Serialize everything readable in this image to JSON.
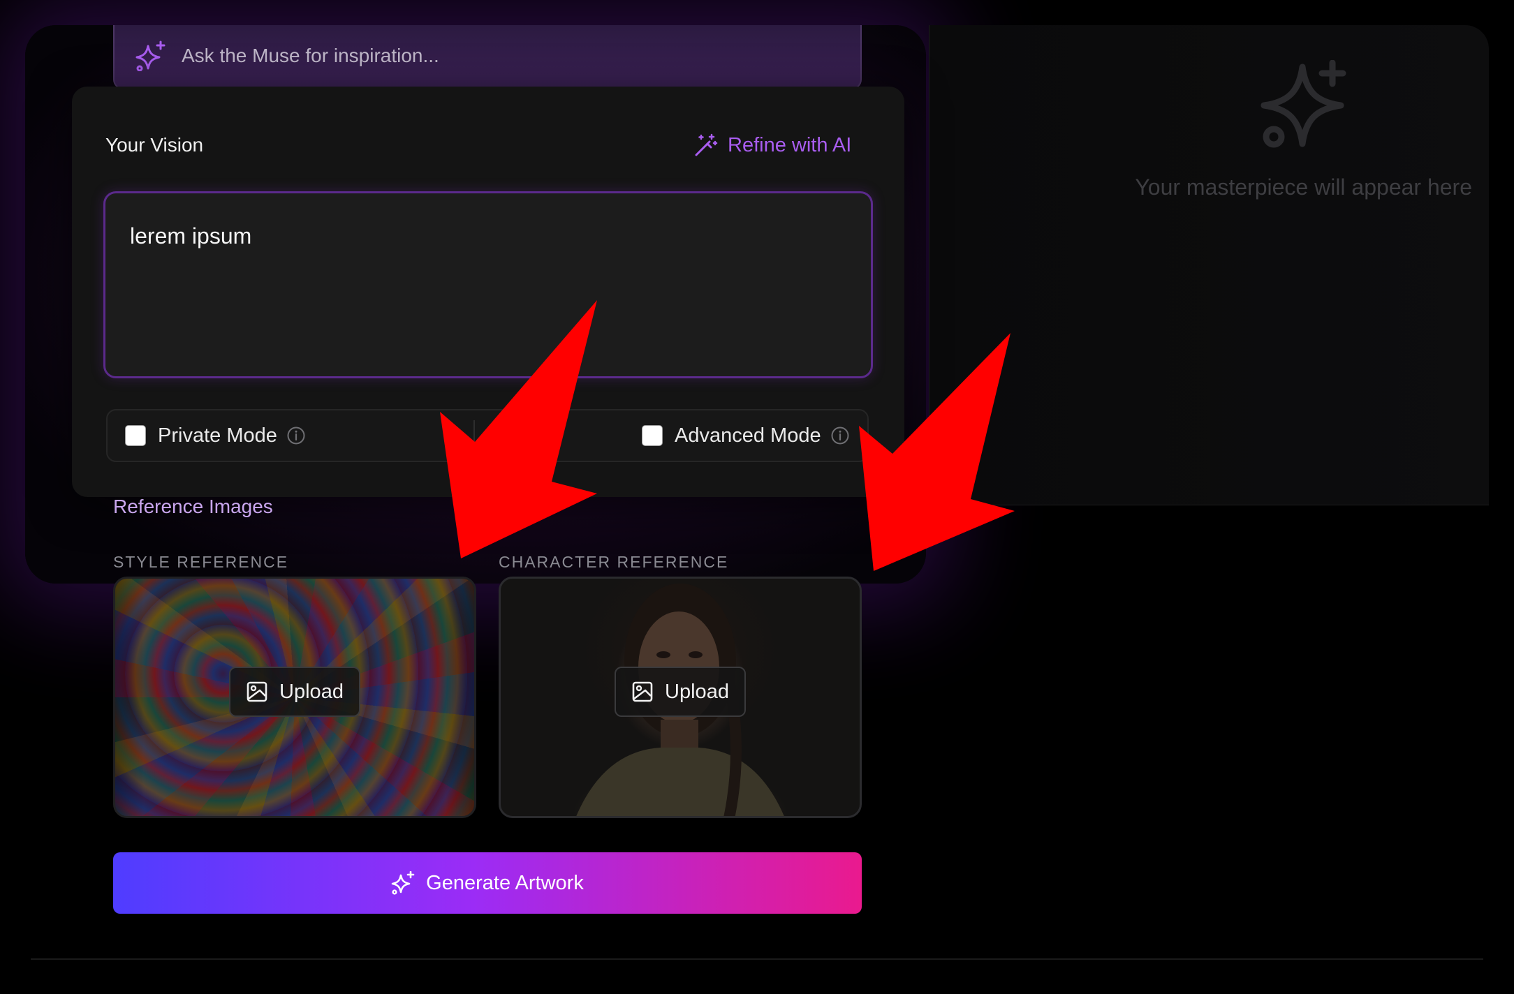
{
  "muse": {
    "placeholder": "Ask the Muse for inspiration..."
  },
  "vision": {
    "label": "Your Vision",
    "refine_label": "Refine with AI",
    "prompt_text": "lerem ipsum"
  },
  "modes": {
    "private_label": "Private Mode",
    "private_checked": false,
    "advanced_label": "Advanced Mode",
    "advanced_checked": false
  },
  "references": {
    "title": "Reference Images",
    "style_label": "STYLE REFERENCE",
    "character_label": "CHARACTER REFERENCE",
    "upload_label": "Upload"
  },
  "generate": {
    "label": "Generate Artwork"
  },
  "preview": {
    "empty_text": "Your masterpiece will appear here"
  },
  "colors": {
    "accent_purple": "#a95df0",
    "gradient_start": "#4f3dff",
    "gradient_mid": "#9b2cf6",
    "gradient_end": "#ea1a8e",
    "annotation_arrow": "#ff0000"
  },
  "icons": {
    "muse": "sparkles-icon",
    "refine": "magic-wand-icon",
    "info": "info-icon",
    "upload": "image-icon",
    "generate": "sparkles-icon",
    "preview": "sparkle-star-icon"
  }
}
